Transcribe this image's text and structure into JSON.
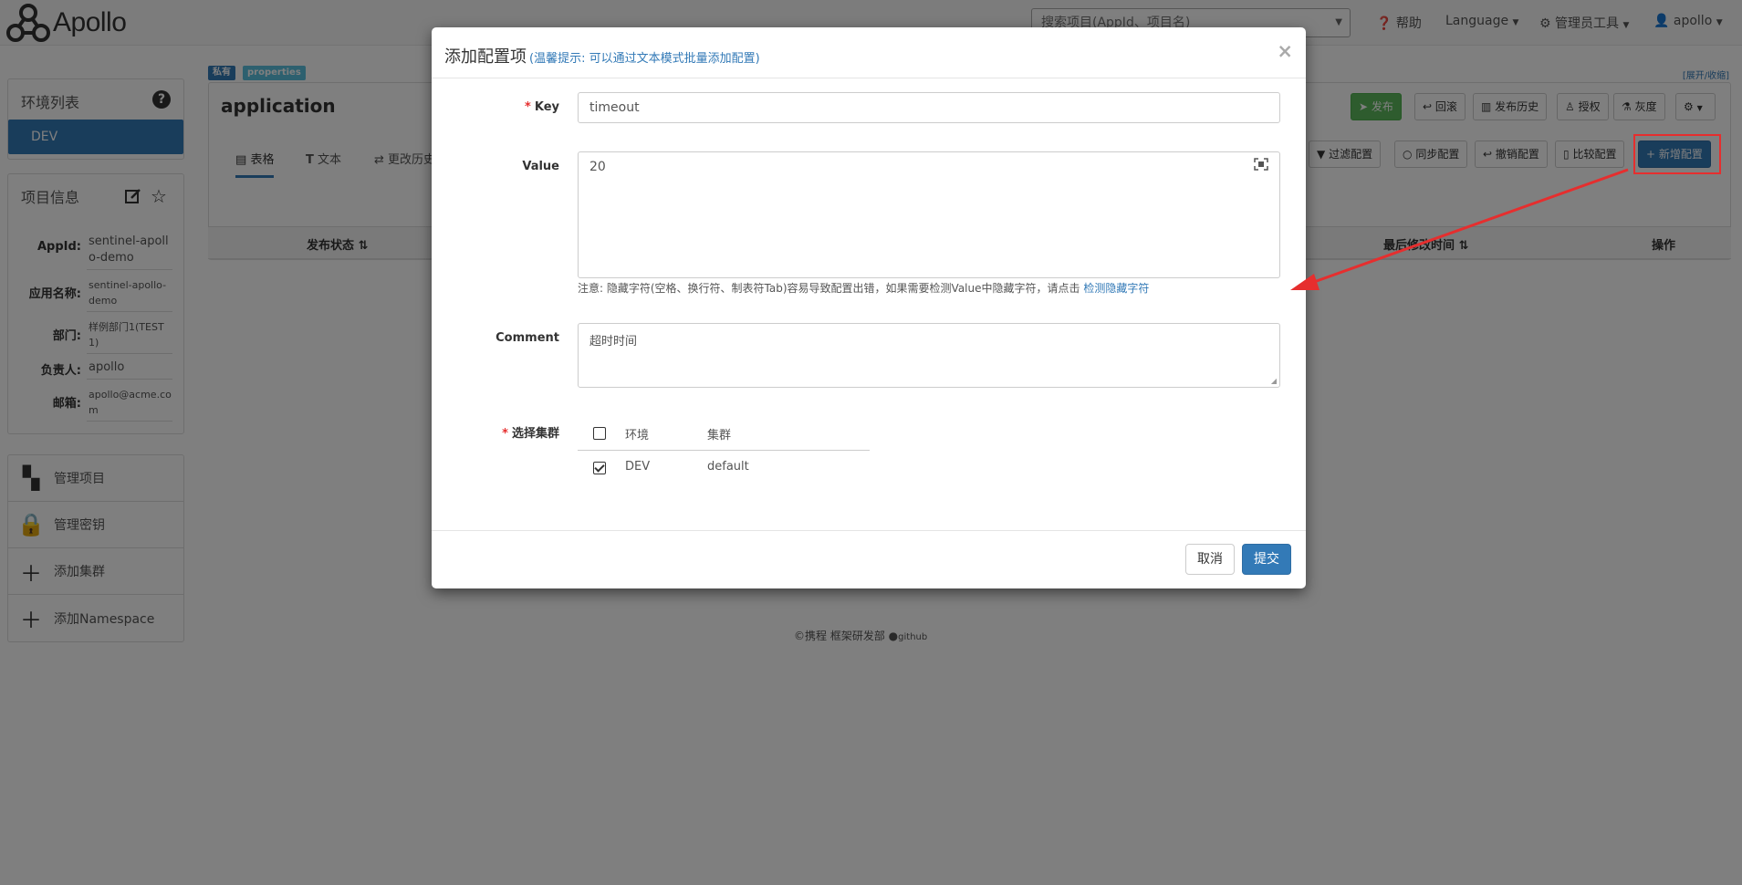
{
  "header": {
    "logo_text": "Apollo",
    "search_placeholder": "搜索项目(AppId、项目名)",
    "help": "帮助",
    "language": "Language",
    "admin_tools": "管理员工具",
    "user": "apollo"
  },
  "sidebar": {
    "env_title": "环境列表",
    "envs": [
      "DEV"
    ],
    "info_title": "项目信息",
    "info": [
      {
        "key": "AppId:",
        "value": "sentinel-apollo-demo"
      },
      {
        "key": "应用名称:",
        "value": "sentinel-apollo-demo"
      },
      {
        "key": "部门:",
        "value": "样例部门1(TEST1)"
      },
      {
        "key": "负责人:",
        "value": "apollo"
      },
      {
        "key": "邮箱:",
        "value": "apollo@acme.com"
      }
    ],
    "menu": [
      {
        "label": "管理项目",
        "icon": "grid-icon"
      },
      {
        "label": "管理密钥",
        "icon": "lock-icon"
      },
      {
        "label": "添加集群",
        "icon": "plus-icon"
      },
      {
        "label": "添加Namespace",
        "icon": "plus-icon"
      }
    ]
  },
  "namespace": {
    "badge_private": "私有",
    "badge_format": "properties",
    "expand_link": "[展开/收缩]",
    "title": "application",
    "actions": {
      "publish": "发布",
      "rollback": "回滚",
      "history": "发布历史",
      "grant": "授权",
      "gray": "灰度"
    },
    "tabs": [
      "表格",
      "文本",
      "更改历史"
    ],
    "toolbar": {
      "filter": "过滤配置",
      "sync": "同步配置",
      "revoke": "撤销配置",
      "compare": "比较配置",
      "add": "新增配置"
    },
    "table_headers": [
      "发布状态",
      "最后修改时间",
      "操作"
    ]
  },
  "footer": {
    "company": "携程 框架研发部",
    "github": "github"
  },
  "modal": {
    "title": "添加配置项",
    "hint": "(温馨提示: 可以通过文本模式批量添加配置)",
    "close": "×",
    "key_label": "Key",
    "key_value": "timeout",
    "value_label": "Value",
    "value_value": "20",
    "value_notice": "注意: 隐藏字符(空格、换行符、制表符Tab)容易导致配置出错，如果需要检测Value中隐藏字符，请点击",
    "value_notice_link": "检测隐藏字符",
    "comment_label": "Comment",
    "comment_value": "超时时间",
    "cluster_label": "选择集群",
    "cluster_table": {
      "headers": [
        "环境",
        "集群"
      ],
      "rows": [
        {
          "env": "DEV",
          "cluster": "default",
          "checked": true
        }
      ]
    },
    "cancel": "取消",
    "submit": "提交"
  }
}
